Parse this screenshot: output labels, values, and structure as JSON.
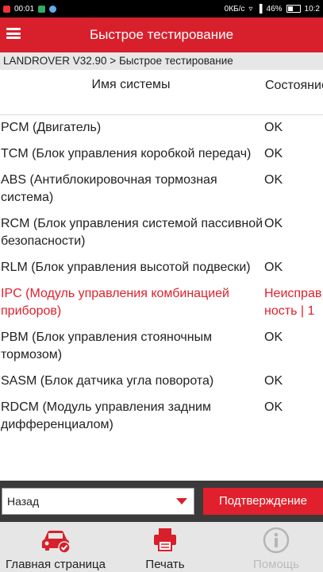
{
  "status_bar": {
    "time_left": "00:01",
    "speed": "0КБ/с",
    "battery": "46%",
    "time_right": "10:2"
  },
  "app_bar": {
    "title": "Быстрое тестирование",
    "menu_icon": "hamburger-menu-icon"
  },
  "breadcrumb": "LANDROVER V32.90 > Быстрое тестирование",
  "table": {
    "headers": {
      "name": "Имя системы",
      "status": "Состояние"
    },
    "rows": [
      {
        "name": "PCM (Двигатель)",
        "status": "OK",
        "error": false
      },
      {
        "name": "TCM (Блок управления коробкой передач)",
        "status": "OK",
        "error": false
      },
      {
        "name": "ABS (Антиблокировочная тормозная система)",
        "status": "OK",
        "error": false
      },
      {
        "name": "RCM (Блок управления системой пассивной безопасности)",
        "status": "OK",
        "error": false
      },
      {
        "name": "RLM (Блок управления высотой подвески)",
        "status": "OK",
        "error": false
      },
      {
        "name": "IPC (Модуль управления комбинацией приборов)",
        "status": "Неисправность | 1",
        "error": true
      },
      {
        "name": "PBM (Блок управления стояночным тормозом)",
        "status": "OK",
        "error": false
      },
      {
        "name": "SASM (Блок датчика угла поворота)",
        "status": "OK",
        "error": false
      },
      {
        "name": "RDCM (Модуль управления задним дифференциалом)",
        "status": "OK",
        "error": false
      }
    ]
  },
  "actions": {
    "select_value": "Назад",
    "confirm_label": "Подтверждение"
  },
  "bottom_nav": {
    "home_label": "Главная страница",
    "print_label": "Печать",
    "help_label": "Помощь"
  },
  "colors": {
    "accent": "#d7202c",
    "error_text": "#e0202c"
  }
}
